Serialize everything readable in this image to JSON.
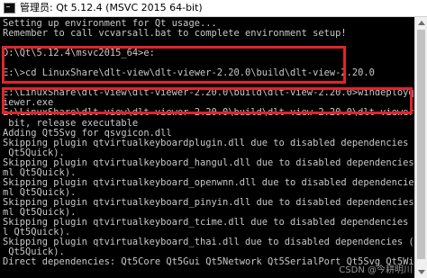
{
  "window": {
    "title": "管理员: Qt 5.12.4 (MSVC 2015 64-bit)"
  },
  "console": {
    "lines": [
      "Setting up environment for Qt usage...",
      "Remember to call vcvarsall.bat to complete environment setup!",
      "",
      "D:\\Qt\\5.12.4\\msvc2015_64>e:",
      "",
      "E:\\>cd LinuxShare\\dlt-view\\dlt-viewer-2.20.0\\build\\dlt-view-2.20.0",
      "",
      "E:\\LinuxShare\\dlt-view\\dlt-viewer-2.20.0\\build\\dlt-view-2.20.0>windeployqt dlt-v",
      "iewer.exe",
      "E:\\LinuxShare\\dlt-view\\dlt-viewer-2.20.0\\build\\dlt-view-2.20.0\\dlt-viewer.exe 64",
      " bit, release executable",
      "Adding Qt5Svg for qsvgicon.dll",
      "Skipping plugin qtvirtualkeyboardplugin.dll due to disabled dependencies (Qt5Qml",
      " Qt5Quick).",
      "Skipping plugin qtvirtualkeyboard_hangul.dll due to disabled dependencies (Qt5Q",
      "ml Qt5Quick).",
      "Skipping plugin qtvirtualkeyboard_openwnn.dll due to disabled dependencies (Qt5Q",
      "ml Qt5Quick).",
      "Skipping plugin qtvirtualkeyboard_pinyin.dll due to disabled dependencies (Qt5Q",
      "ml Qt5Quick).",
      "Skipping plugin qtvirtualkeyboard_tcime.dll due to disabled dependencies (Qt5Qm",
      "l Qt5Quick).",
      "Skipping plugin qtvirtualkeyboard_thai.dll due to disabled dependencies (Qt5Qml",
      " Qt5Quick).",
      "Direct dependencies: Qt5Core Qt5Gui Qt5Network Qt5SerialPort Qt5Svg Qt5Widg"
    ]
  },
  "watermark": "CSDN @今耕明川",
  "colors": {
    "console_background": "#000000",
    "console_text": "#c8c8c8",
    "highlight_border": "#e3232b",
    "titlebar_background": "#ffffff"
  },
  "icons": {
    "app": "console-icon",
    "scroll_up": "scroll-up-arrow-icon",
    "scroll_down": "scroll-down-arrow-icon"
  }
}
